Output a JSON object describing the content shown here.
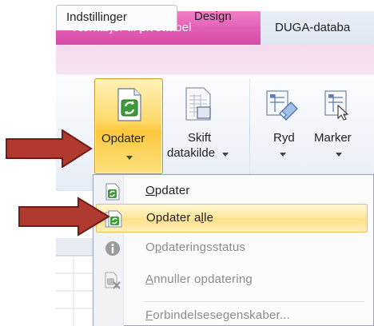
{
  "contextual_tab": {
    "label": "Værktøjer til pivottabel"
  },
  "document_title": "DUGA-databa",
  "tabs": [
    {
      "label": "Indstillinger",
      "active": true
    },
    {
      "label": "Design",
      "active": false
    }
  ],
  "ribbon": {
    "cut_off_label": "øj",
    "buttons": [
      {
        "name": "opdater",
        "label": "Opdater",
        "icon": "refresh-icon"
      },
      {
        "name": "skift-datakilde",
        "label_line1": "Skift",
        "label_line2": "datakilde",
        "icon": "datasource-icon"
      },
      {
        "name": "ryd",
        "label": "Ryd",
        "icon": "eraser-icon"
      },
      {
        "name": "marker",
        "label": "Marker",
        "icon": "select-icon"
      }
    ]
  },
  "menu": {
    "items": [
      {
        "pre": "",
        "key": "O",
        "post": "pdater",
        "icon": "refresh-icon",
        "disabled": false,
        "highlighted": false
      },
      {
        "pre": "Opdater a",
        "key": "l",
        "post": "le",
        "icon": "refresh-all-icon",
        "disabled": false,
        "highlighted": true
      },
      {
        "pre": "O",
        "key": "p",
        "post": "dateringsstatus",
        "icon": "info-icon",
        "disabled": true,
        "highlighted": false
      },
      {
        "pre": "",
        "key": "A",
        "post": "nnuller opdatering",
        "icon": "cancel-refresh-icon",
        "disabled": true,
        "highlighted": false
      },
      {
        "pre": "",
        "key": "F",
        "post": "orbindelsesegenskaber...",
        "icon": "",
        "disabled": true,
        "highlighted": false
      }
    ]
  },
  "colors": {
    "contextual_tab": "#e25db5",
    "highlight": "#ffe79a",
    "arrow": "#b5382f"
  }
}
